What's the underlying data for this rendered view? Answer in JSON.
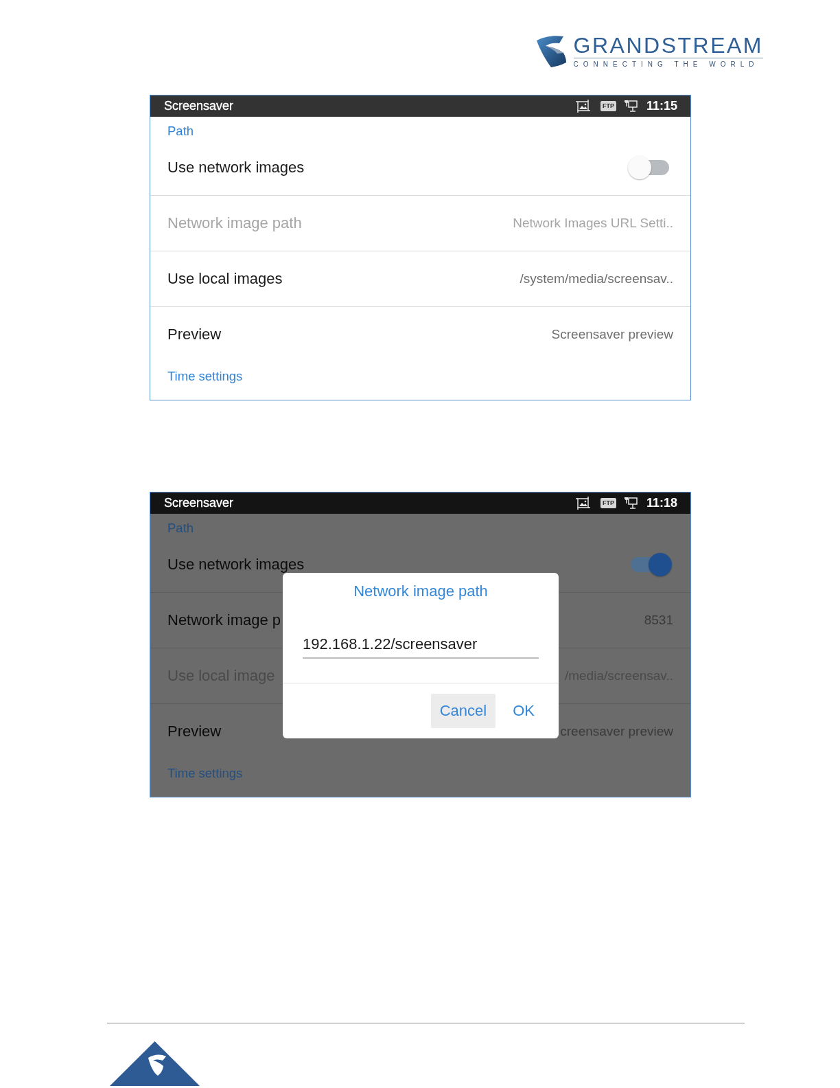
{
  "header": {
    "logo": {
      "wordmark": "GRANDSTREAM",
      "tagline": "CONNECTING THE WORLD"
    }
  },
  "screens": [
    {
      "status_bar": {
        "title": "Screensaver",
        "ftp": "FTP",
        "time": "11:15"
      },
      "items": [
        {
          "kind": "category",
          "title": "Path"
        },
        {
          "kind": "switch",
          "title": "Use network images",
          "on": false,
          "disabled": false
        },
        {
          "kind": "value",
          "title": "Network image path",
          "value": "Network Images URL Setti..",
          "disabled": true
        },
        {
          "kind": "value",
          "title": "Use local images",
          "value": "/system/media/screensav..",
          "disabled": false
        },
        {
          "kind": "value",
          "title": "Preview",
          "value": "Screensaver preview",
          "disabled": false
        },
        {
          "kind": "category",
          "title": "Time settings"
        }
      ]
    },
    {
      "status_bar": {
        "title": "Screensaver",
        "ftp": "FTP",
        "time": "11:18"
      },
      "items": [
        {
          "kind": "category",
          "title": "Path"
        },
        {
          "kind": "switch",
          "title": "Use network images",
          "on": true,
          "disabled": false
        },
        {
          "kind": "value",
          "title": "Network image p",
          "value": "8531",
          "disabled": false
        },
        {
          "kind": "value",
          "title": "Use local image",
          "value": "/media/screensav..",
          "disabled": true
        },
        {
          "kind": "value",
          "title": "Preview",
          "value": "creensaver preview",
          "disabled": false
        },
        {
          "kind": "category",
          "title": "Time settings"
        }
      ],
      "dialog": {
        "title": "Network image path",
        "input": {
          "value": "192.168.1.22/screensaver"
        },
        "buttons": [
          {
            "label": "Cancel",
            "focused": true
          },
          {
            "label": "OK",
            "focused": false
          }
        ]
      }
    }
  ]
}
